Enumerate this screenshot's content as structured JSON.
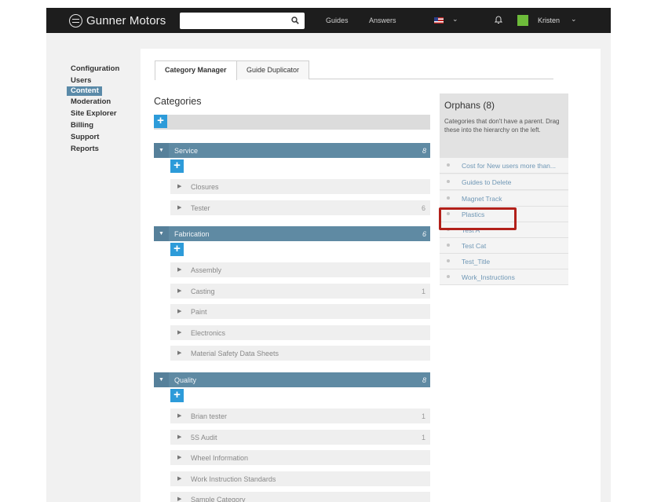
{
  "brand": {
    "name": "Gunner Motors"
  },
  "header": {
    "search_placeholder": "",
    "nav": [
      "Guides",
      "Answers"
    ],
    "user": "Kristen"
  },
  "sidebar": {
    "items": [
      {
        "label": "Configuration",
        "active": false
      },
      {
        "label": "Users",
        "active": false
      },
      {
        "label": "Content",
        "active": true
      },
      {
        "label": "Moderation",
        "active": false
      },
      {
        "label": "Site Explorer",
        "active": false
      },
      {
        "label": "Billing",
        "active": false
      },
      {
        "label": "Support",
        "active": false
      },
      {
        "label": "Reports",
        "active": false
      }
    ]
  },
  "tabs": [
    "Category Manager",
    "Guide Duplicator"
  ],
  "categories": {
    "title": "Categories",
    "add_symbol": "+",
    "groups": [
      {
        "name": "Service",
        "count": "8",
        "children": [
          {
            "name": "Closures",
            "count": ""
          },
          {
            "name": "Tester",
            "count": "6"
          }
        ]
      },
      {
        "name": "Fabrication",
        "count": "6",
        "children": [
          {
            "name": "Assembly",
            "count": ""
          },
          {
            "name": "Casting",
            "count": "1"
          },
          {
            "name": "Paint",
            "count": ""
          },
          {
            "name": "Electronics",
            "count": ""
          },
          {
            "name": "Material Safety Data Sheets",
            "count": ""
          }
        ]
      },
      {
        "name": "Quality",
        "count": "8",
        "children": [
          {
            "name": "Brian tester",
            "count": "1"
          },
          {
            "name": "5S Audit",
            "count": "1"
          },
          {
            "name": "Wheel Information",
            "count": ""
          },
          {
            "name": "Work Instruction Standards",
            "count": ""
          },
          {
            "name": "Sample Category",
            "count": ""
          }
        ]
      }
    ]
  },
  "orphans": {
    "title": "Orphans (8)",
    "description": "Categories that don't have a parent. Drag these into the hierarchy on the left.",
    "items": [
      "Cost for New users more than...",
      "Guides to Delete",
      "Magnet Track",
      "Plastics",
      "Test A",
      "Test Cat",
      "Test_Title",
      "Work_Instructions"
    ],
    "highlighted": "Plastics"
  },
  "colors": {
    "topbar": "#1d1d1d",
    "group_header": "#5f8aa3",
    "add_button": "#2d9bd9",
    "highlight_box": "#b2201a",
    "link": "#6f97b5"
  }
}
